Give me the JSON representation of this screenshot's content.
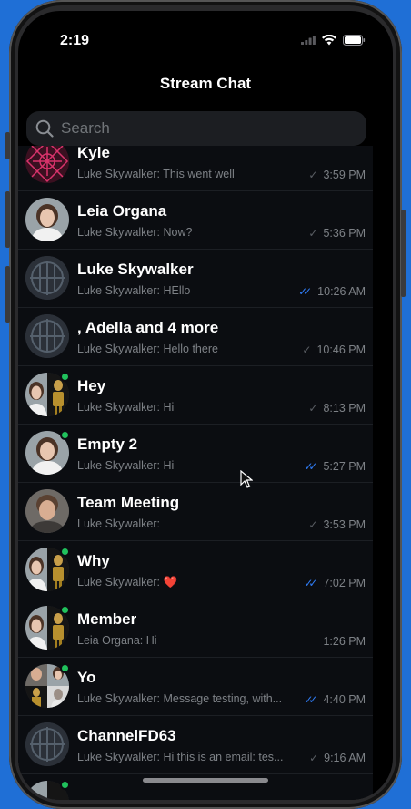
{
  "status_bar": {
    "time": "2:19"
  },
  "nav": {
    "title": "Stream Chat"
  },
  "search": {
    "placeholder": "Search"
  },
  "channels": [
    {
      "name": "Kyle",
      "preview": "Luke Skywalker: This went well",
      "time": "3:59 PM",
      "receipt": "sent",
      "avatar": "pattern-avatar",
      "online": false
    },
    {
      "name": "Leia Organa",
      "preview": "Luke Skywalker: Now?",
      "time": "5:36 PM",
      "receipt": "sent",
      "avatar": "leia-avatar",
      "online": false
    },
    {
      "name": "Luke Skywalker",
      "preview": "Luke Skywalker: HEllo",
      "time": "10:26 AM",
      "receipt": "read",
      "avatar": "emblem-avatar",
      "online": false
    },
    {
      "name": ", Adella and 4 more",
      "preview": "Luke Skywalker: Hello there",
      "time": "10:46 PM",
      "receipt": "sent",
      "avatar": "emblem-avatar",
      "online": false
    },
    {
      "name": "Hey",
      "preview": "Luke Skywalker: Hi",
      "time": "8:13 PM",
      "receipt": "sent",
      "avatar": "leia-droid-avatar",
      "online": true
    },
    {
      "name": "Empty 2",
      "preview": "Luke Skywalker: Hi",
      "time": "5:27 PM",
      "receipt": "read",
      "avatar": "leia-avatar",
      "online": true
    },
    {
      "name": "Team Meeting",
      "preview": "Luke Skywalker:",
      "time": "3:53 PM",
      "receipt": "sent",
      "avatar": "han-avatar",
      "online": false
    },
    {
      "name": "Why",
      "preview": "Luke Skywalker: ❤️",
      "time": "7:02 PM",
      "receipt": "read",
      "avatar": "leia-droid-avatar",
      "online": true
    },
    {
      "name": "Member",
      "preview": "Leia Organa: Hi",
      "time": "1:26 PM",
      "receipt": "none",
      "avatar": "leia-droid-avatar",
      "online": true
    },
    {
      "name": "Yo",
      "preview": "Luke Skywalker: Message testing, with...",
      "time": "4:40 PM",
      "receipt": "read",
      "avatar": "group-avatar",
      "online": true
    },
    {
      "name": "ChannelFD63",
      "preview": "Luke Skywalker: Hi this is an email: tes...",
      "time": "9:16 AM",
      "receipt": "sent",
      "avatar": "emblem-avatar",
      "online": false
    }
  ],
  "colors": {
    "accent": "#2f7cf6",
    "online": "#20c15c",
    "background": "#0b0d11",
    "wallpaper": "#1f6fd6"
  }
}
